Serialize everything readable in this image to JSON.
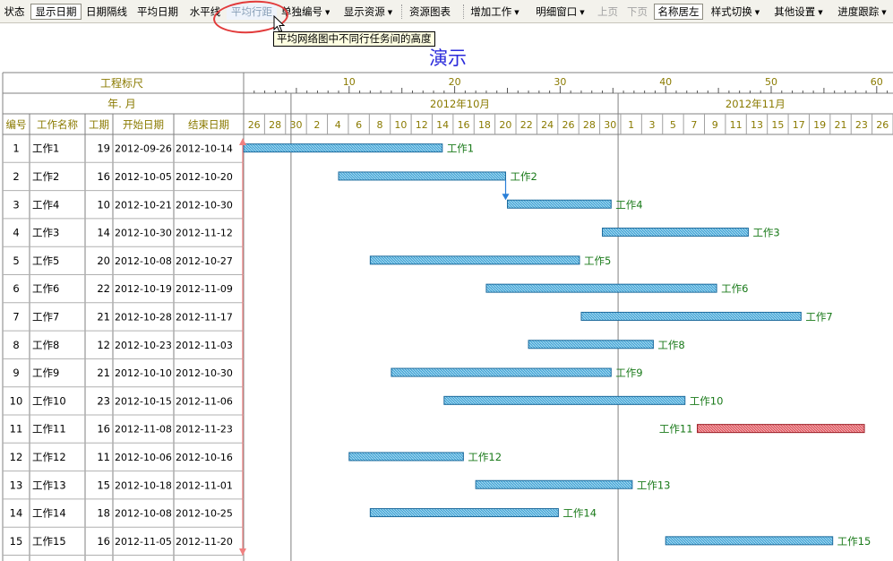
{
  "toolbar": {
    "items": [
      {
        "label": "状态",
        "state": "normal"
      },
      {
        "label": "显示日期",
        "state": "pressed"
      },
      {
        "label": "日期隔线",
        "state": "normal"
      },
      {
        "label": "平均日期",
        "state": "normal"
      },
      {
        "label": "水平线",
        "state": "normal"
      },
      {
        "label": "平均行距",
        "state": "hover"
      },
      {
        "label": "单独编号",
        "state": "dropdown"
      },
      {
        "label": "显示资源",
        "state": "dropdown"
      },
      {
        "label": "资源图表",
        "state": "normal"
      },
      {
        "label": "增加工作",
        "state": "dropdown"
      },
      {
        "label": "明细窗口",
        "state": "dropdown"
      },
      {
        "label": "上页",
        "state": "disabled"
      },
      {
        "label": "下页",
        "state": "disabled"
      },
      {
        "label": "名称居左",
        "state": "pressed"
      },
      {
        "label": "样式切换",
        "state": "dropdown"
      },
      {
        "label": "其他设置",
        "state": "dropdown"
      },
      {
        "label": "进度跟踪",
        "state": "dropdown"
      }
    ],
    "tooltip": "平均网络图中不同行任务间的高度"
  },
  "chart_title": "演示",
  "colors": {
    "bar_fill": "#4aa8d8",
    "bar_border": "#1d6a9c",
    "bar_highlight_fill": "#e05a62",
    "bar_highlight_border": "#9a1c24",
    "bar_label": "#1a7a1a",
    "header_text": "#8a7a00",
    "dependency_arrow": "#2a7fd8",
    "date_marker": "#f08080"
  },
  "grid": {
    "ruler_label": "工程标尺",
    "yearmonth_label": "年. 月",
    "columns": [
      "编号",
      "工作名称",
      "工期",
      "开始日期",
      "结束日期"
    ],
    "ruler_ticks": [
      "10",
      "20",
      "30",
      "40",
      "50",
      "60"
    ],
    "months": [
      "2012年10月",
      "2012年11月"
    ],
    "day_labels": [
      "26",
      "28",
      "30",
      "2",
      "4",
      "6",
      "8",
      "10",
      "12",
      "14",
      "16",
      "18",
      "20",
      "22",
      "24",
      "26",
      "28",
      "30",
      "1",
      "3",
      "5",
      "7",
      "9",
      "11",
      "13",
      "15",
      "17",
      "19",
      "21",
      "23",
      "26"
    ]
  },
  "chart_data": {
    "type": "gantt",
    "title": "演示",
    "x_axis": "date",
    "xlim": [
      "2012-09-26",
      "2012-11-26"
    ],
    "tasks": [
      {
        "id": "1",
        "name": "工作1",
        "duration": "19",
        "start": "2012-09-26",
        "end": "2012-10-14",
        "highlight": false
      },
      {
        "id": "2",
        "name": "工作2",
        "duration": "16",
        "start": "2012-10-05",
        "end": "2012-10-20",
        "highlight": false
      },
      {
        "id": "3",
        "name": "工作4",
        "duration": "10",
        "start": "2012-10-21",
        "end": "2012-10-30",
        "highlight": false
      },
      {
        "id": "4",
        "name": "工作3",
        "duration": "14",
        "start": "2012-10-30",
        "end": "2012-11-12",
        "highlight": false
      },
      {
        "id": "5",
        "name": "工作5",
        "duration": "20",
        "start": "2012-10-08",
        "end": "2012-10-27",
        "highlight": false
      },
      {
        "id": "6",
        "name": "工作6",
        "duration": "22",
        "start": "2012-10-19",
        "end": "2012-11-09",
        "highlight": false
      },
      {
        "id": "7",
        "name": "工作7",
        "duration": "21",
        "start": "2012-10-28",
        "end": "2012-11-17",
        "highlight": false
      },
      {
        "id": "8",
        "name": "工作8",
        "duration": "12",
        "start": "2012-10-23",
        "end": "2012-11-03",
        "highlight": false
      },
      {
        "id": "9",
        "name": "工作9",
        "duration": "21",
        "start": "2012-10-10",
        "end": "2012-10-30",
        "highlight": false
      },
      {
        "id": "10",
        "name": "工作10",
        "duration": "23",
        "start": "2012-10-15",
        "end": "2012-11-06",
        "highlight": false
      },
      {
        "id": "11",
        "name": "工作11",
        "duration": "16",
        "start": "2012-11-08",
        "end": "2012-11-23",
        "highlight": true
      },
      {
        "id": "12",
        "name": "工作12",
        "duration": "11",
        "start": "2012-10-06",
        "end": "2012-10-16",
        "highlight": false
      },
      {
        "id": "13",
        "name": "工作13",
        "duration": "15",
        "start": "2012-10-18",
        "end": "2012-11-01",
        "highlight": false
      },
      {
        "id": "14",
        "name": "工作14",
        "duration": "18",
        "start": "2012-10-08",
        "end": "2012-10-25",
        "highlight": false
      },
      {
        "id": "15",
        "name": "工作15",
        "duration": "16",
        "start": "2012-11-05",
        "end": "2012-11-20",
        "highlight": false
      }
    ],
    "dependencies": [
      {
        "from": "2",
        "to": "3"
      }
    ]
  }
}
